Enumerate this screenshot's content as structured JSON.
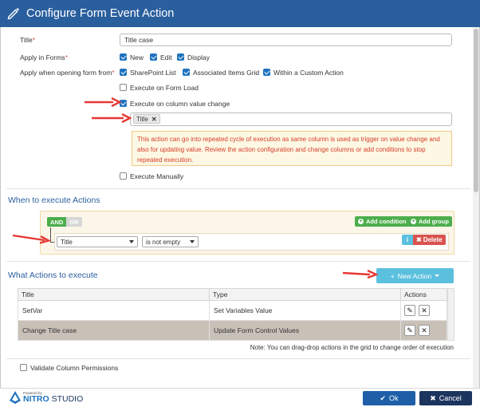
{
  "header": {
    "title": "Configure Form Event Action"
  },
  "form": {
    "title_label": "Title",
    "title_value": "Title case",
    "apply_in_forms_label": "Apply in Forms",
    "forms_options": [
      {
        "label": "New",
        "checked": true
      },
      {
        "label": "Edit",
        "checked": true
      },
      {
        "label": "Display",
        "checked": true
      }
    ],
    "apply_when_label": "Apply when opening form from",
    "open_from_options": [
      {
        "label": "SharePoint List",
        "checked": true
      },
      {
        "label": "Associated Items Grid",
        "checked": true
      },
      {
        "label": "Within a Custom Action",
        "checked": true
      }
    ],
    "execute_on_load": {
      "label": "Execute on Form Load",
      "checked": false
    },
    "execute_on_change": {
      "label": "Execute on column value change",
      "checked": true
    },
    "column_tag": "Title",
    "warning": "This action can go into repeated cycle of execution as same column is used as trigger on value change and also for updating value. Review the action configuration and change columns or add conditions to stop repeated execution.",
    "execute_manually": {
      "label": "Execute Manually",
      "checked": false
    }
  },
  "when": {
    "title": "When to execute Actions",
    "and_label": "AND",
    "or_label": "OR",
    "add_condition_label": "Add condition",
    "add_group_label": "Add group",
    "rule_field": "Title",
    "rule_operator": "is not empty",
    "info_label": "i",
    "delete_label": "Delete"
  },
  "what": {
    "title": "What Actions to execute",
    "new_action_label": "New Action",
    "columns": [
      "Title",
      "Type",
      "Actions"
    ],
    "rows": [
      {
        "title": "SetVar",
        "type": "Set Variables Value"
      },
      {
        "title": "Change Title case",
        "type": "Update Form Control Values"
      }
    ],
    "note": "Note: You can drag-drop actions in the grid to change order of execution"
  },
  "validate": {
    "label": "Validate Column Permissions",
    "checked": false
  },
  "footer": {
    "powered_by": "Powered by",
    "brand_a": "NITRO",
    "brand_b": "STUDIO",
    "ok_label": "Ok",
    "cancel_label": "Cancel"
  },
  "colors": {
    "header_bg": "#2a5f9e",
    "primary": "#1e5fa8",
    "success": "#4cae4c",
    "danger": "#d9534f",
    "info": "#5bc0de",
    "annotation_arrow": "#e53935"
  }
}
